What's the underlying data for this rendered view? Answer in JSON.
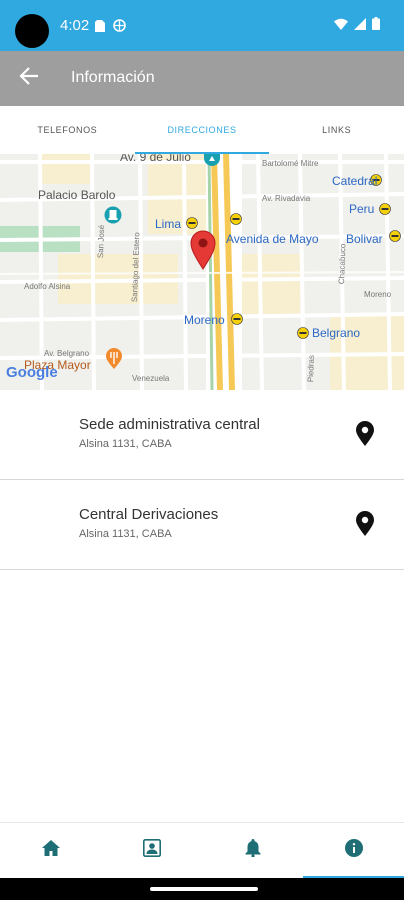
{
  "status_bar": {
    "time": "4:02"
  },
  "app_bar": {
    "title": "Información"
  },
  "tabs": [
    {
      "label": "TELEFONOS"
    },
    {
      "label": "DIRECCIONES"
    },
    {
      "label": "LINKS"
    }
  ],
  "map": {
    "labels": {
      "av_9_julio": "Av. 9 de Julio",
      "bartolome_mitre": "Bartolomé Mitre",
      "palacio_barolo": "Palacio Barolo",
      "av_rivadavia": "Av. Rivadavia",
      "catedral": "Catedral",
      "peru": "Peru",
      "lima": "Lima",
      "avenida_de_mayo": "Avenida de Mayo",
      "bolivar": "Bolivar",
      "san_jose": "San José",
      "santiago_del_estero": "Santiago del Estero",
      "adolfo_alsina": "Adolfo Alsina",
      "chacabuco": "Chacabuco",
      "moreno_street": "Moreno",
      "moreno_station": "Moreno",
      "belgrano_station": "Belgrano",
      "av_belgrano": "Av. Belgrano",
      "plaza_mayor": "Plaza Mayor",
      "venezuela": "Venezuela",
      "piedras": "Piedras",
      "google": "Google"
    }
  },
  "addresses": [
    {
      "name": "Sede administrativa central",
      "detail": "Alsina 1131, CABA"
    },
    {
      "name": "Central Derivaciones",
      "detail": "Alsina 1131, CABA"
    }
  ],
  "nav": [
    {
      "icon": "home-icon"
    },
    {
      "icon": "contact-icon"
    },
    {
      "icon": "bell-icon"
    },
    {
      "icon": "info-icon"
    }
  ],
  "colors": {
    "status_bar": "#30a8e0",
    "app_bar": "#9e9e9e",
    "accent": "#30a8e0",
    "teal_icon": "#1f6e76",
    "map_pin": "#e53935"
  }
}
